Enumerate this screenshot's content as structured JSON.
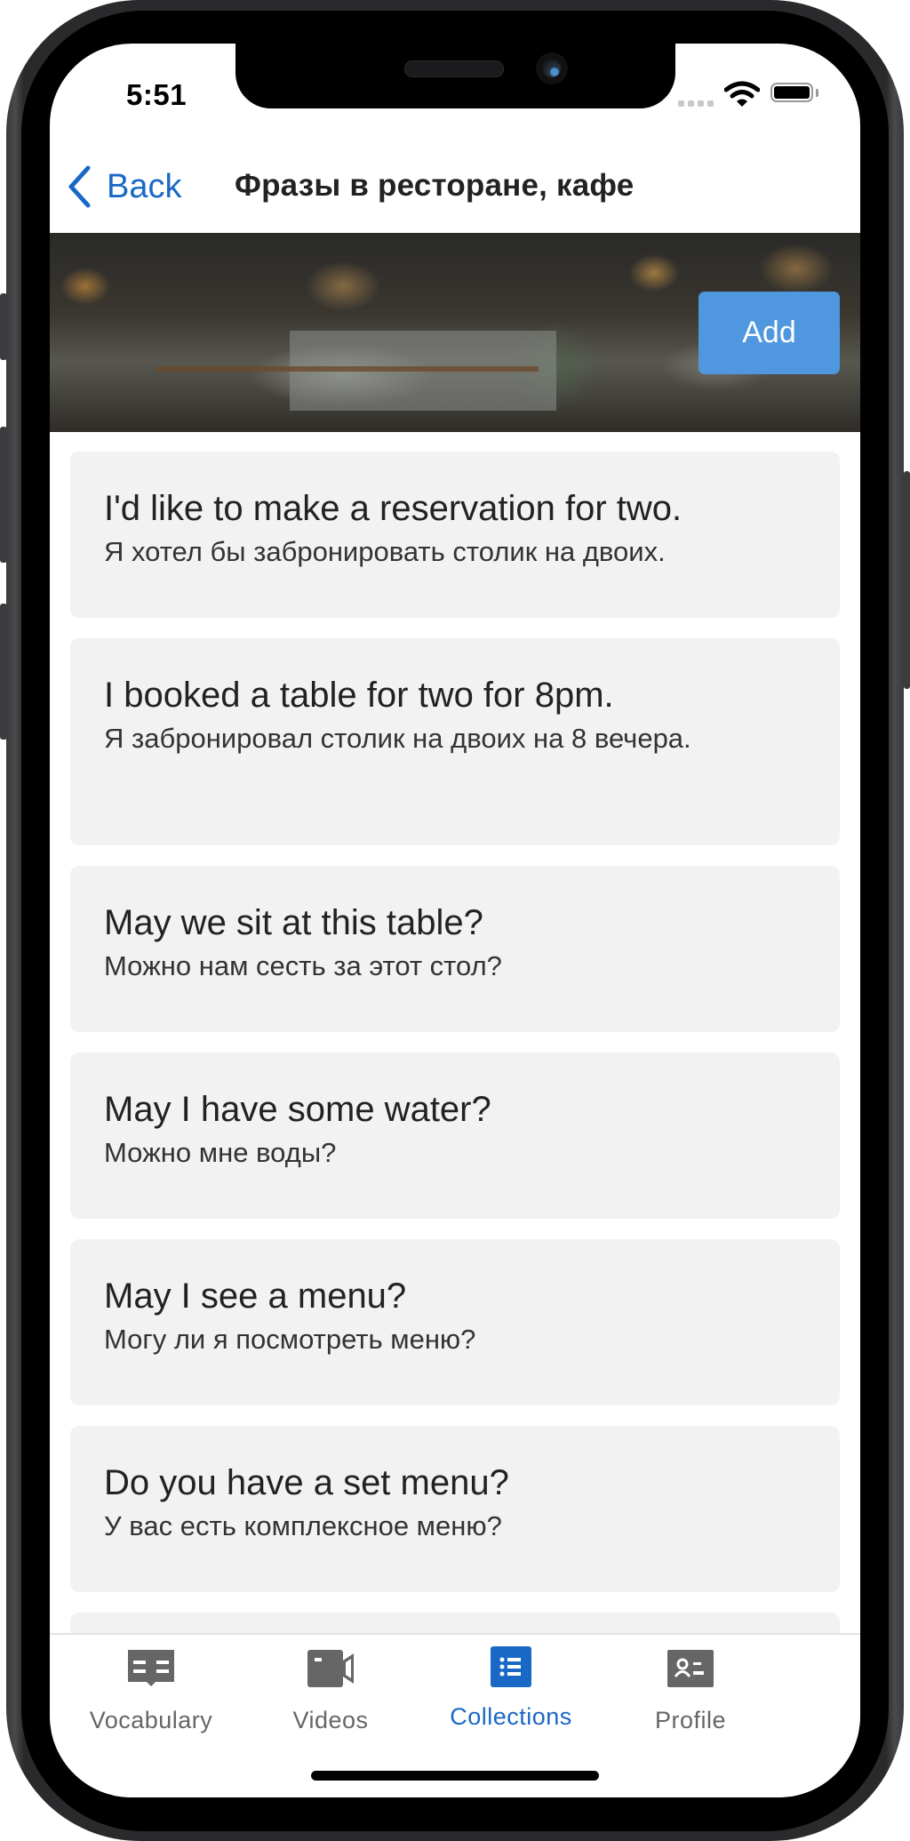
{
  "status_bar": {
    "time": "5:51",
    "icons": [
      "signal-dots-icon",
      "wifi-icon",
      "battery-icon"
    ]
  },
  "nav": {
    "back_label": "Back",
    "back_icon": "chevron-left-icon",
    "title": "Фразы в ресторане, кафе"
  },
  "banner": {
    "image": "cafe-interior-photo",
    "add_label": "Add"
  },
  "phrases": [
    {
      "en": "I'd like to make a reservation for two.",
      "ru": "Я хотел бы забронировать столик на двоих."
    },
    {
      "en": "I booked a table for two for 8pm.",
      "ru": "Я забронировал столик на двоих на 8 вечера."
    },
    {
      "en": "May we sit at this table?",
      "ru": "Можно нам сесть за этот стол?"
    },
    {
      "en": "May I have some water?",
      "ru": "Можно мне воды?"
    },
    {
      "en": "May I see a menu?",
      "ru": "Могу ли я посмотреть меню?"
    },
    {
      "en": "Do you have a set menu?",
      "ru": "У вас есть комплексное меню?"
    }
  ],
  "tabbar": {
    "tabs": [
      {
        "label": "Vocabulary",
        "icon": "open-book-icon",
        "active": false
      },
      {
        "label": "Videos",
        "icon": "video-camera-icon",
        "active": false
      },
      {
        "label": "Collections",
        "icon": "list-icon",
        "active": true
      },
      {
        "label": "Profile",
        "icon": "contact-card-icon",
        "active": false
      }
    ]
  },
  "colors": {
    "accent": "#1a68c6",
    "add_button": "#4f97de",
    "card_background": "#f2f2f2",
    "inactive_tab": "#666666"
  }
}
